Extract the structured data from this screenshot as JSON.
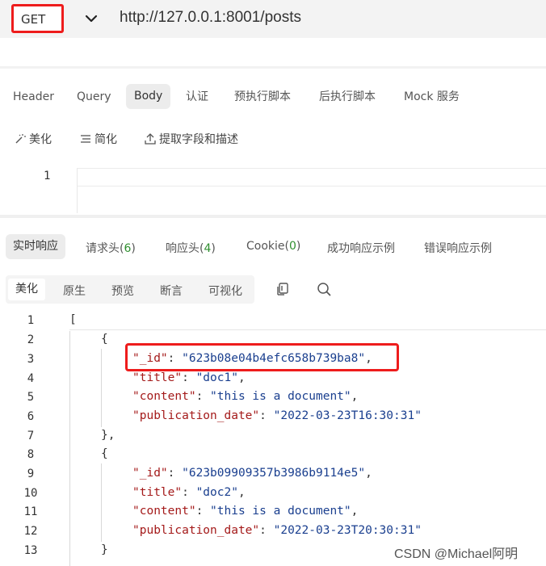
{
  "request": {
    "method": "GET",
    "url": "http://127.0.0.1:8001/posts"
  },
  "request_tabs": [
    "Header",
    "Query",
    "Body",
    "认证",
    "预执行脚本",
    "后执行脚本",
    "Mock 服务"
  ],
  "tools": [
    "美化",
    "简化",
    "提取字段和描述"
  ],
  "editor": {
    "line_number": "1"
  },
  "response_tabs": {
    "realtime": "实时响应",
    "req_headers": "请求头(",
    "req_headers_count": "6",
    "resp_headers": "响应头(",
    "resp_headers_count": "4",
    "cookie": "Cookie(",
    "cookie_count": "0",
    "close": ")",
    "success_example": "成功响应示例",
    "error_example": "错误响应示例"
  },
  "view_tabs": [
    "美化",
    "原生",
    "预览",
    "断言",
    "可视化"
  ],
  "line_numbers": [
    "1",
    "2",
    "3",
    "4",
    "5",
    "6",
    "7",
    "8",
    "9",
    "10",
    "11",
    "12",
    "13"
  ],
  "json": {
    "records": [
      {
        "_id_key": "\"_id\"",
        "_id": "\"623b08e04b4efc658b739ba8\"",
        "title_key": "\"title\"",
        "title": "\"doc1\"",
        "content_key": "\"content\"",
        "content": "\"this is a document\"",
        "date_key": "\"publication_date\"",
        "date": "\"2022-03-23T16:30:31\""
      },
      {
        "_id_key": "\"_id\"",
        "_id": "\"623b09909357b3986b9114e5\"",
        "title_key": "\"title\"",
        "title": "\"doc2\"",
        "content_key": "\"content\"",
        "content": "\"this is a document\"",
        "date_key": "\"publication_date\"",
        "date": "\"2022-03-23T20:30:31\""
      }
    ]
  },
  "watermark": "CSDN @Michael阿明",
  "colors": {
    "highlight": "#ee1c1c",
    "key": "#a41a1a",
    "string": "#1a3f8f",
    "count": "#2f8f2f"
  }
}
